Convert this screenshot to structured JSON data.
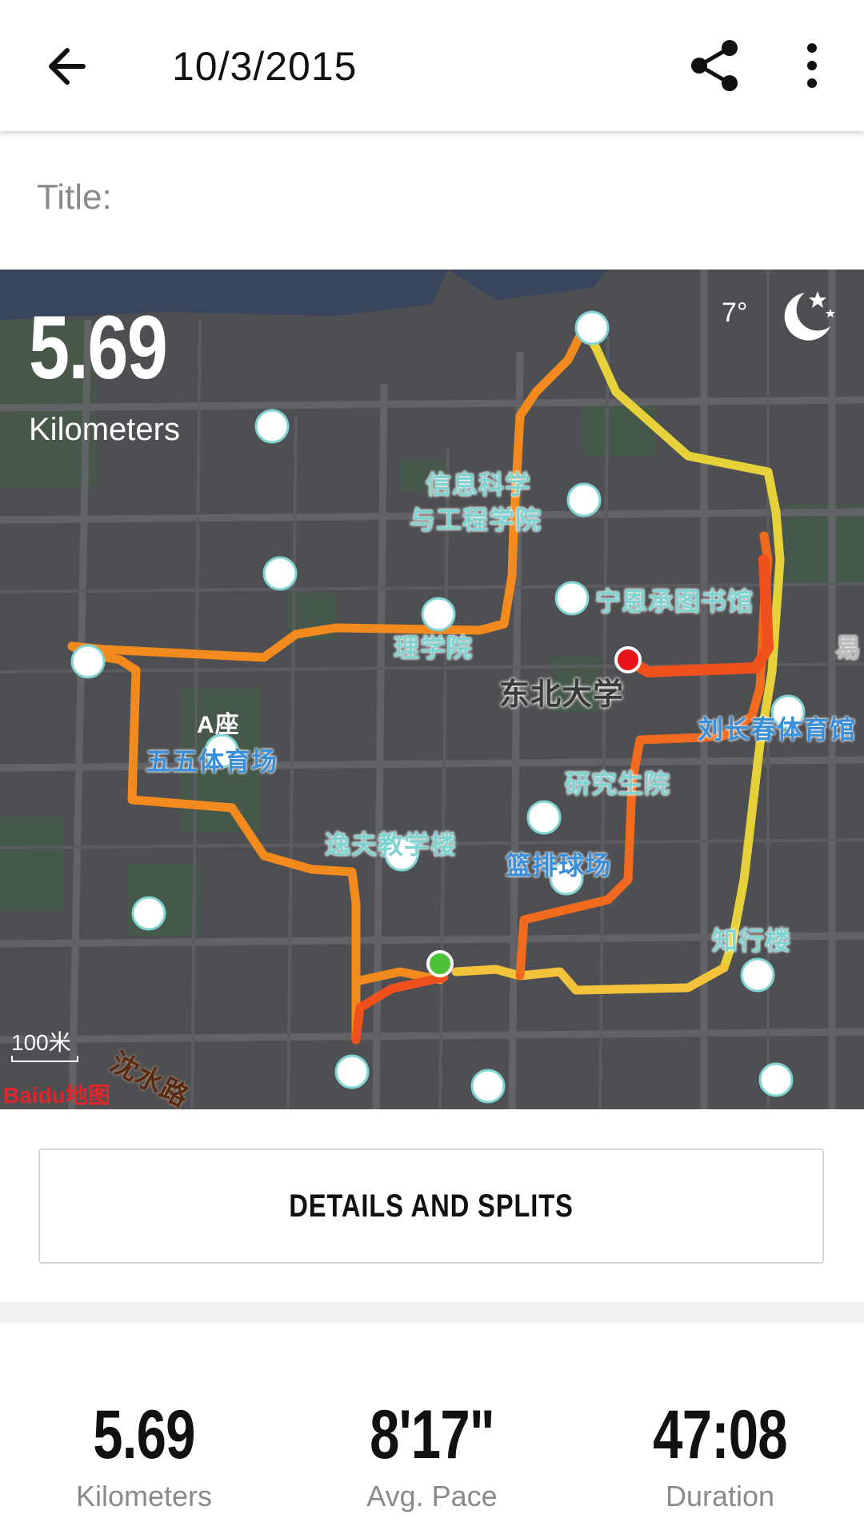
{
  "header": {
    "date": "10/3/2015"
  },
  "title_label": "Title:",
  "map": {
    "distance_value": "5.69",
    "distance_unit": "Kilometers",
    "temperature": "7°",
    "weather_icon": "moon-stars-icon",
    "scale_label": "100米",
    "provider": "Baidu地图",
    "labels": {
      "a_zuo": "A座",
      "xinxi": "信息科学",
      "xinxi2": "与工程学院",
      "library": "宁恩承图书馆",
      "lixueyuan": "理学院",
      "neu": "东北大学",
      "yi": "易",
      "stadium": "刘长春体育馆",
      "wuwu": "五五体育场",
      "yanjiusheng": "研究生院",
      "yifu": "逸夫教学楼",
      "basketball": "篮排球场",
      "zhixing": "知行楼",
      "road": "沈水路"
    }
  },
  "details_button": "DETAILS AND SPLITS",
  "stats": [
    {
      "value": "5.69",
      "label": "Kilometers"
    },
    {
      "value": "8'17\"",
      "label": "Avg. Pace"
    },
    {
      "value": "47:08",
      "label": "Duration"
    }
  ],
  "colors": {
    "route_start": "#f2de3a",
    "route_end": "#f04e1a",
    "start_marker": "#4cc236",
    "end_marker": "#e8121a"
  }
}
